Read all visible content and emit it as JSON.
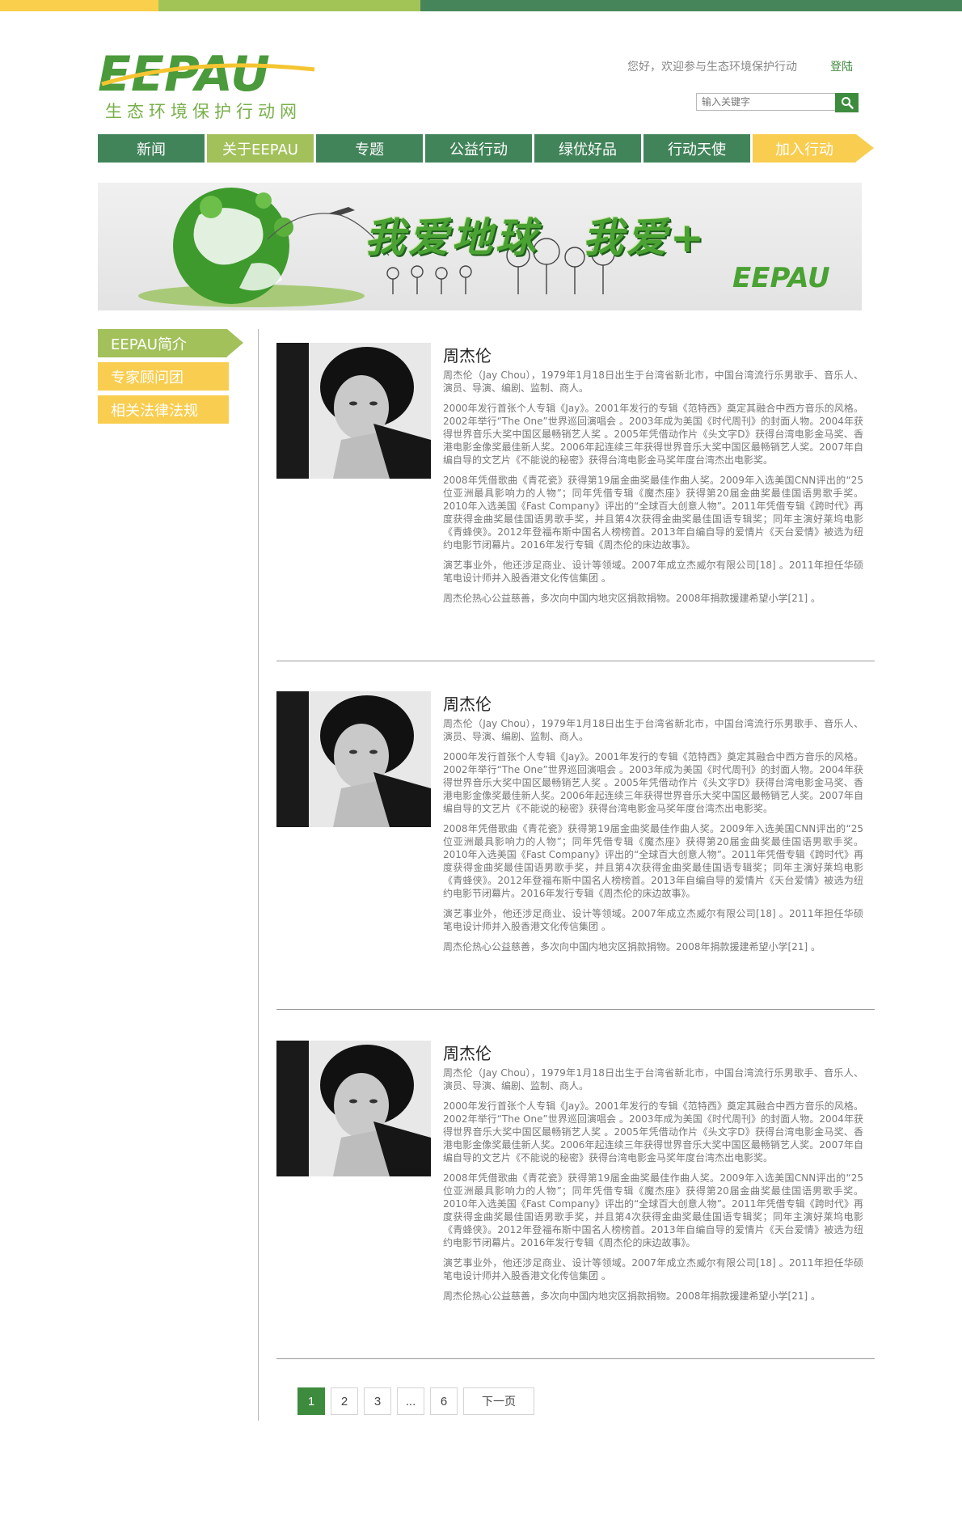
{
  "header": {
    "logo_text": "EEPAU",
    "logo_subtitle": "生态环境保护行动网",
    "welcome_text": "您好，欢迎参与生态环境保护行动",
    "login_label": "登陆",
    "search_placeholder": "输入关键字"
  },
  "nav": {
    "items": [
      {
        "label": "新闻"
      },
      {
        "label": "关于EEPAU"
      },
      {
        "label": "专题"
      },
      {
        "label": "公益行动"
      },
      {
        "label": "绿优好品"
      },
      {
        "label": "行动天使"
      },
      {
        "label": "加入行动"
      }
    ]
  },
  "banner": {
    "title": "我爱地球　我爱+",
    "logo": "EEPAU"
  },
  "sidebar": {
    "items": [
      {
        "label": "EEPAU简介"
      },
      {
        "label": "专家顾问团"
      },
      {
        "label": "相关法律法规"
      }
    ]
  },
  "articles": [
    {
      "name": "周杰伦",
      "paragraphs": [
        "周杰伦（Jay Chou），1979年1月18日出生于台湾省新北市，中国台湾流行乐男歌手、音乐人、演员、导演、编剧、监制、商人。",
        "2000年发行首张个人专辑《Jay》。2001年发行的专辑《范特西》奠定其融合中西方音乐的风格。2002年举行“The One”世界巡回演唱会 。2003年成为美国《时代周刊》的封面人物。2004年获得世界音乐大奖中国区最畅销艺人奖 。2005年凭借动作片《头文字D》获得台湾电影金马奖、香港电影金像奖最佳新人奖。2006年起连续三年获得世界音乐大奖中国区最畅销艺人奖。2007年自编自导的文艺片《不能说的秘密》获得台湾电影金马奖年度台湾杰出电影奖。",
        "2008年凭借歌曲《青花瓷》获得第19届金曲奖最佳作曲人奖。2009年入选美国CNN评出的“25位亚洲最具影响力的人物”；同年凭借专辑《魔杰座》获得第20届金曲奖最佳国语男歌手奖。2010年入选美国《Fast Company》评出的“全球百大创意人物”。2011年凭借专辑《跨时代》再度获得金曲奖最佳国语男歌手奖，并且第4次获得金曲奖最佳国语专辑奖；同年主演好莱坞电影《青蜂侠》。2012年登福布斯中国名人榜榜首。2013年自编自导的爱情片《天台爱情》被选为纽约电影节闭幕片。2016年发行专辑《周杰伦的床边故事》。",
        "演艺事业外，他还涉足商业、设计等领域。2007年成立杰威尔有限公司[18] 。2011年担任华硕笔电设计师并入股香港文化传信集团 。",
        "周杰伦热心公益慈善，多次向中国内地灾区捐款捐物。2008年捐款援建希望小学[21] 。"
      ]
    },
    {
      "name": "周杰伦",
      "paragraphs": [
        "周杰伦（Jay Chou），1979年1月18日出生于台湾省新北市，中国台湾流行乐男歌手、音乐人、演员、导演、编剧、监制、商人。",
        "2000年发行首张个人专辑《Jay》。2001年发行的专辑《范特西》奠定其融合中西方音乐的风格。2002年举行“The One”世界巡回演唱会 。2003年成为美国《时代周刊》的封面人物。2004年获得世界音乐大奖中国区最畅销艺人奖 。2005年凭借动作片《头文字D》获得台湾电影金马奖、香港电影金像奖最佳新人奖。2006年起连续三年获得世界音乐大奖中国区最畅销艺人奖。2007年自编自导的文艺片《不能说的秘密》获得台湾电影金马奖年度台湾杰出电影奖。",
        "2008年凭借歌曲《青花瓷》获得第19届金曲奖最佳作曲人奖。2009年入选美国CNN评出的“25位亚洲最具影响力的人物”；同年凭借专辑《魔杰座》获得第20届金曲奖最佳国语男歌手奖。2010年入选美国《Fast Company》评出的“全球百大创意人物”。2011年凭借专辑《跨时代》再度获得金曲奖最佳国语男歌手奖，并且第4次获得金曲奖最佳国语专辑奖；同年主演好莱坞电影《青蜂侠》。2012年登福布斯中国名人榜榜首。2013年自编自导的爱情片《天台爱情》被选为纽约电影节闭幕片。2016年发行专辑《周杰伦的床边故事》。",
        "演艺事业外，他还涉足商业、设计等领域。2007年成立杰威尔有限公司[18] 。2011年担任华硕笔电设计师并入股香港文化传信集团 。",
        "周杰伦热心公益慈善，多次向中国内地灾区捐款捐物。2008年捐款援建希望小学[21] 。"
      ]
    },
    {
      "name": "周杰伦",
      "paragraphs": [
        "周杰伦（Jay Chou），1979年1月18日出生于台湾省新北市，中国台湾流行乐男歌手、音乐人、演员、导演、编剧、监制、商人。",
        "2000年发行首张个人专辑《Jay》。2001年发行的专辑《范特西》奠定其融合中西方音乐的风格。2002年举行“The One”世界巡回演唱会 。2003年成为美国《时代周刊》的封面人物。2004年获得世界音乐大奖中国区最畅销艺人奖 。2005年凭借动作片《头文字D》获得台湾电影金马奖、香港电影金像奖最佳新人奖。2006年起连续三年获得世界音乐大奖中国区最畅销艺人奖。2007年自编自导的文艺片《不能说的秘密》获得台湾电影金马奖年度台湾杰出电影奖。",
        "2008年凭借歌曲《青花瓷》获得第19届金曲奖最佳作曲人奖。2009年入选美国CNN评出的“25位亚洲最具影响力的人物”；同年凭借专辑《魔杰座》获得第20届金曲奖最佳国语男歌手奖。2010年入选美国《Fast Company》评出的“全球百大创意人物”。2011年凭借专辑《跨时代》再度获得金曲奖最佳国语男歌手奖，并且第4次获得金曲奖最佳国语专辑奖；同年主演好莱坞电影《青蜂侠》。2012年登福布斯中国名人榜榜首。2013年自编自导的爱情片《天台爱情》被选为纽约电影节闭幕片。2016年发行专辑《周杰伦的床边故事》。",
        "演艺事业外，他还涉足商业、设计等领域。2007年成立杰威尔有限公司[18] 。2011年担任华硕笔电设计师并入股香港文化传信集团 。",
        "周杰伦热心公益慈善，多次向中国内地灾区捐款捐物。2008年捐款援建希望小学[21] 。"
      ]
    }
  ],
  "pagination": {
    "pages": [
      "1",
      "2",
      "3",
      "...",
      "6"
    ],
    "current": "1",
    "next_label": "下一页"
  },
  "colors": {
    "dark_green": "#42845a",
    "light_green": "#a3c15b",
    "yellow": "#f9cd4f"
  }
}
